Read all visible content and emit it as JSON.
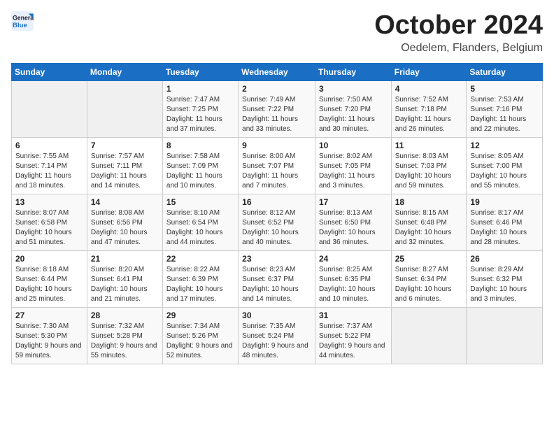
{
  "logo": {
    "general": "General",
    "blue": "Blue"
  },
  "header": {
    "month": "October 2024",
    "location": "Oedelem, Flanders, Belgium"
  },
  "weekdays": [
    "Sunday",
    "Monday",
    "Tuesday",
    "Wednesday",
    "Thursday",
    "Friday",
    "Saturday"
  ],
  "weeks": [
    [
      {
        "day": "",
        "sunrise": "",
        "sunset": "",
        "daylight": ""
      },
      {
        "day": "",
        "sunrise": "",
        "sunset": "",
        "daylight": ""
      },
      {
        "day": "1",
        "sunrise": "Sunrise: 7:47 AM",
        "sunset": "Sunset: 7:25 PM",
        "daylight": "Daylight: 11 hours and 37 minutes."
      },
      {
        "day": "2",
        "sunrise": "Sunrise: 7:49 AM",
        "sunset": "Sunset: 7:22 PM",
        "daylight": "Daylight: 11 hours and 33 minutes."
      },
      {
        "day": "3",
        "sunrise": "Sunrise: 7:50 AM",
        "sunset": "Sunset: 7:20 PM",
        "daylight": "Daylight: 11 hours and 30 minutes."
      },
      {
        "day": "4",
        "sunrise": "Sunrise: 7:52 AM",
        "sunset": "Sunset: 7:18 PM",
        "daylight": "Daylight: 11 hours and 26 minutes."
      },
      {
        "day": "5",
        "sunrise": "Sunrise: 7:53 AM",
        "sunset": "Sunset: 7:16 PM",
        "daylight": "Daylight: 11 hours and 22 minutes."
      }
    ],
    [
      {
        "day": "6",
        "sunrise": "Sunrise: 7:55 AM",
        "sunset": "Sunset: 7:14 PM",
        "daylight": "Daylight: 11 hours and 18 minutes."
      },
      {
        "day": "7",
        "sunrise": "Sunrise: 7:57 AM",
        "sunset": "Sunset: 7:11 PM",
        "daylight": "Daylight: 11 hours and 14 minutes."
      },
      {
        "day": "8",
        "sunrise": "Sunrise: 7:58 AM",
        "sunset": "Sunset: 7:09 PM",
        "daylight": "Daylight: 11 hours and 10 minutes."
      },
      {
        "day": "9",
        "sunrise": "Sunrise: 8:00 AM",
        "sunset": "Sunset: 7:07 PM",
        "daylight": "Daylight: 11 hours and 7 minutes."
      },
      {
        "day": "10",
        "sunrise": "Sunrise: 8:02 AM",
        "sunset": "Sunset: 7:05 PM",
        "daylight": "Daylight: 11 hours and 3 minutes."
      },
      {
        "day": "11",
        "sunrise": "Sunrise: 8:03 AM",
        "sunset": "Sunset: 7:03 PM",
        "daylight": "Daylight: 10 hours and 59 minutes."
      },
      {
        "day": "12",
        "sunrise": "Sunrise: 8:05 AM",
        "sunset": "Sunset: 7:00 PM",
        "daylight": "Daylight: 10 hours and 55 minutes."
      }
    ],
    [
      {
        "day": "13",
        "sunrise": "Sunrise: 8:07 AM",
        "sunset": "Sunset: 6:58 PM",
        "daylight": "Daylight: 10 hours and 51 minutes."
      },
      {
        "day": "14",
        "sunrise": "Sunrise: 8:08 AM",
        "sunset": "Sunset: 6:56 PM",
        "daylight": "Daylight: 10 hours and 47 minutes."
      },
      {
        "day": "15",
        "sunrise": "Sunrise: 8:10 AM",
        "sunset": "Sunset: 6:54 PM",
        "daylight": "Daylight: 10 hours and 44 minutes."
      },
      {
        "day": "16",
        "sunrise": "Sunrise: 8:12 AM",
        "sunset": "Sunset: 6:52 PM",
        "daylight": "Daylight: 10 hours and 40 minutes."
      },
      {
        "day": "17",
        "sunrise": "Sunrise: 8:13 AM",
        "sunset": "Sunset: 6:50 PM",
        "daylight": "Daylight: 10 hours and 36 minutes."
      },
      {
        "day": "18",
        "sunrise": "Sunrise: 8:15 AM",
        "sunset": "Sunset: 6:48 PM",
        "daylight": "Daylight: 10 hours and 32 minutes."
      },
      {
        "day": "19",
        "sunrise": "Sunrise: 8:17 AM",
        "sunset": "Sunset: 6:46 PM",
        "daylight": "Daylight: 10 hours and 28 minutes."
      }
    ],
    [
      {
        "day": "20",
        "sunrise": "Sunrise: 8:18 AM",
        "sunset": "Sunset: 6:44 PM",
        "daylight": "Daylight: 10 hours and 25 minutes."
      },
      {
        "day": "21",
        "sunrise": "Sunrise: 8:20 AM",
        "sunset": "Sunset: 6:41 PM",
        "daylight": "Daylight: 10 hours and 21 minutes."
      },
      {
        "day": "22",
        "sunrise": "Sunrise: 8:22 AM",
        "sunset": "Sunset: 6:39 PM",
        "daylight": "Daylight: 10 hours and 17 minutes."
      },
      {
        "day": "23",
        "sunrise": "Sunrise: 8:23 AM",
        "sunset": "Sunset: 6:37 PM",
        "daylight": "Daylight: 10 hours and 14 minutes."
      },
      {
        "day": "24",
        "sunrise": "Sunrise: 8:25 AM",
        "sunset": "Sunset: 6:35 PM",
        "daylight": "Daylight: 10 hours and 10 minutes."
      },
      {
        "day": "25",
        "sunrise": "Sunrise: 8:27 AM",
        "sunset": "Sunset: 6:34 PM",
        "daylight": "Daylight: 10 hours and 6 minutes."
      },
      {
        "day": "26",
        "sunrise": "Sunrise: 8:29 AM",
        "sunset": "Sunset: 6:32 PM",
        "daylight": "Daylight: 10 hours and 3 minutes."
      }
    ],
    [
      {
        "day": "27",
        "sunrise": "Sunrise: 7:30 AM",
        "sunset": "Sunset: 5:30 PM",
        "daylight": "Daylight: 9 hours and 59 minutes."
      },
      {
        "day": "28",
        "sunrise": "Sunrise: 7:32 AM",
        "sunset": "Sunset: 5:28 PM",
        "daylight": "Daylight: 9 hours and 55 minutes."
      },
      {
        "day": "29",
        "sunrise": "Sunrise: 7:34 AM",
        "sunset": "Sunset: 5:26 PM",
        "daylight": "Daylight: 9 hours and 52 minutes."
      },
      {
        "day": "30",
        "sunrise": "Sunrise: 7:35 AM",
        "sunset": "Sunset: 5:24 PM",
        "daylight": "Daylight: 9 hours and 48 minutes."
      },
      {
        "day": "31",
        "sunrise": "Sunrise: 7:37 AM",
        "sunset": "Sunset: 5:22 PM",
        "daylight": "Daylight: 9 hours and 44 minutes."
      },
      {
        "day": "",
        "sunrise": "",
        "sunset": "",
        "daylight": ""
      },
      {
        "day": "",
        "sunrise": "",
        "sunset": "",
        "daylight": ""
      }
    ]
  ]
}
